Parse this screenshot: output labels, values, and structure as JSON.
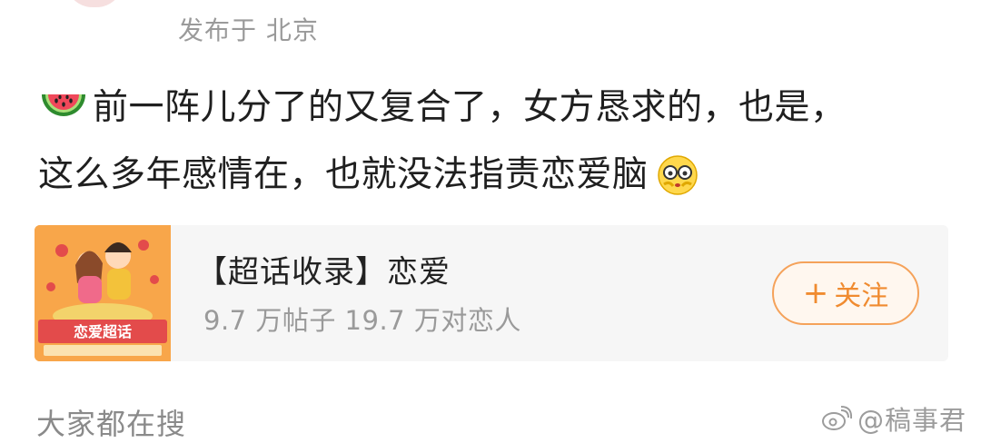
{
  "header": {
    "location": "发布于 北京"
  },
  "post": {
    "line1": "前一阵儿分了的又复合了，女方恳求的，也是，",
    "line2": "这么多年感情在，也就没法指责恋爱脑",
    "emoji_start": "watermelon-emoji",
    "emoji_end": "shy-face-emoji"
  },
  "topic": {
    "title": "【超话收录】恋爱",
    "meta": "9.7 万帖子 19.7 万对恋人",
    "follow_label": "关注",
    "cover_banner": "恋爱超话",
    "cover_accent": "#f8a64a"
  },
  "section": {
    "title": "大家都在搜"
  },
  "watermark": {
    "text": "@稿事君",
    "icon": "weibo-logo-icon"
  },
  "colors": {
    "accent": "#f08b30",
    "muted": "#9a9a9a",
    "card_bg": "#f6f6f6"
  }
}
